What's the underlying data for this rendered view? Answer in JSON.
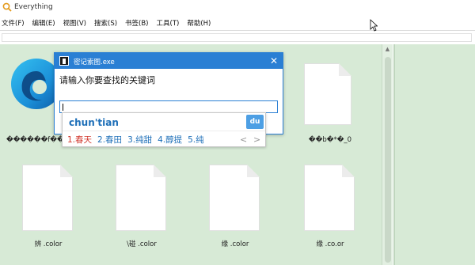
{
  "window": {
    "title": "Everything"
  },
  "menu": [
    "文件(F)",
    "编辑(E)",
    "视图(V)",
    "搜索(S)",
    "书签(B)",
    "工具(T)",
    "帮助(H)"
  ],
  "files": [
    {
      "label": "������f��������"
    },
    {
      "label": "��b�*�_0"
    },
    {
      "label": "辨   .color"
    },
    {
      "label": "\\碰  .color"
    },
    {
      "label": "缘  .color"
    },
    {
      "label": "缘  .co.or"
    }
  ],
  "dialog": {
    "title": "密记索图.exe",
    "prompt": "请输入你要查找的关键词",
    "input_value": "",
    "close_glyph": "✕"
  },
  "ime": {
    "composition": "chun'tian",
    "logo": "du",
    "candidates": [
      "1.春天",
      "2.春田",
      "3.纯甜",
      "4.醇提",
      "5.纯"
    ],
    "prev_glyph": "<",
    "next_glyph": ">"
  },
  "colors": {
    "content_bg": "#d7ead6",
    "dialog_accent": "#2a7fd4",
    "ime_text": "#1e6fb8",
    "ime_first": "#d0352b"
  }
}
